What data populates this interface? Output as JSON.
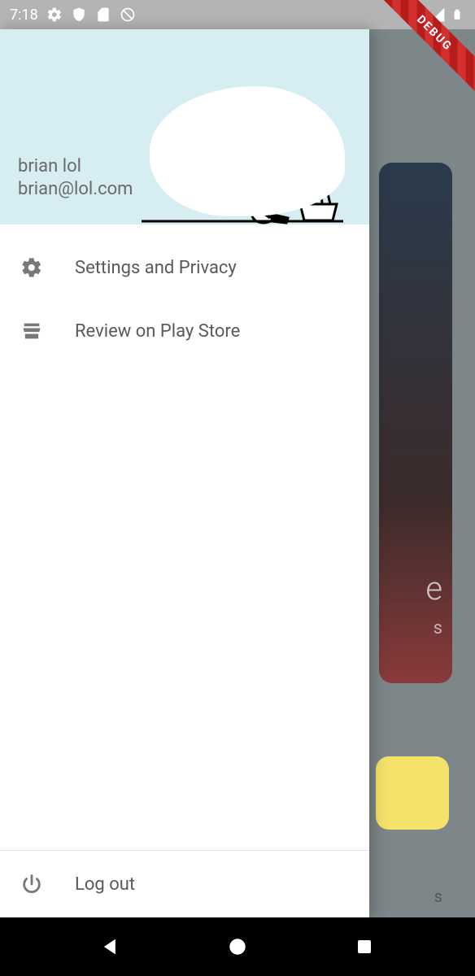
{
  "status": {
    "time": "7:18"
  },
  "debug_label": "DEBUG",
  "background": {
    "card_title_fragment": "e",
    "card_subtitle_fragment": "s",
    "card2_fragment": "s"
  },
  "drawer": {
    "user": {
      "name": "brian lol",
      "email": "brian@lol.com"
    },
    "items": [
      {
        "label": "Settings and Privacy"
      },
      {
        "label": "Review on Play Store"
      }
    ],
    "footer": {
      "label": "Log out"
    }
  }
}
